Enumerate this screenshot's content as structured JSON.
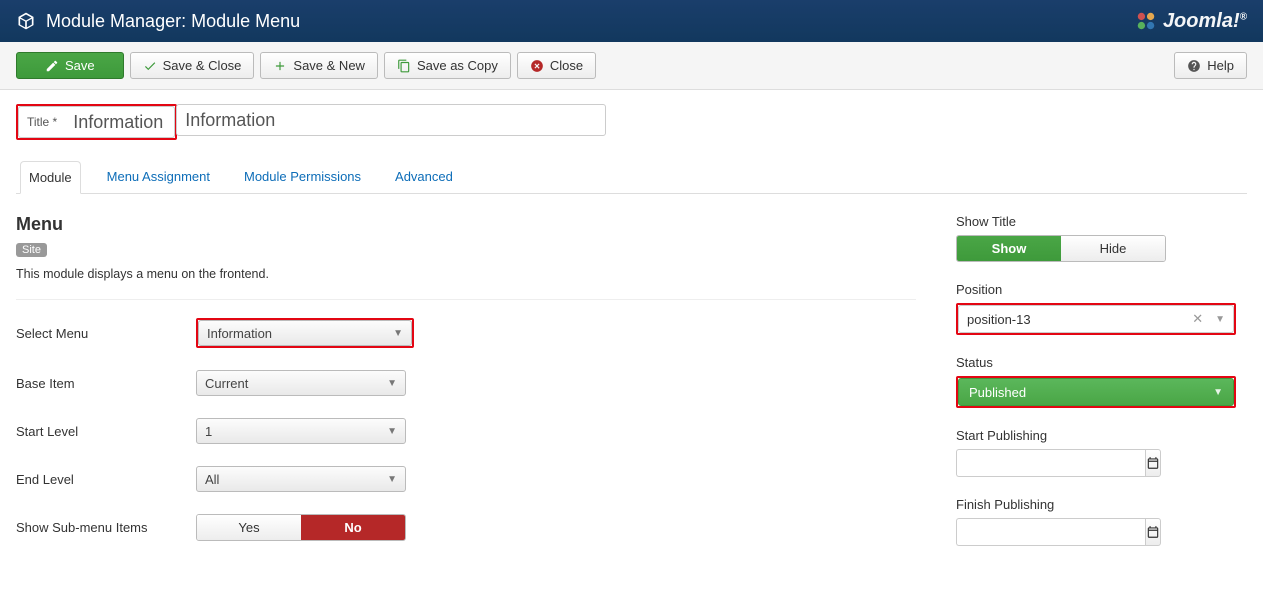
{
  "header": {
    "title": "Module Manager: Module Menu",
    "brand": "Joomla!"
  },
  "toolbar": {
    "save": "Save",
    "save_close": "Save & Close",
    "save_new": "Save & New",
    "save_copy": "Save as Copy",
    "close": "Close",
    "help": "Help"
  },
  "title_field": {
    "label": "Title *",
    "value": "Information"
  },
  "tabs": {
    "module": "Module",
    "menu_assignment": "Menu Assignment",
    "module_permissions": "Module Permissions",
    "advanced": "Advanced"
  },
  "module_section": {
    "heading": "Menu",
    "site_badge": "Site",
    "description": "This module displays a menu on the frontend."
  },
  "fields": {
    "select_menu": {
      "label": "Select Menu",
      "value": "Information"
    },
    "base_item": {
      "label": "Base Item",
      "value": "Current"
    },
    "start_level": {
      "label": "Start Level",
      "value": "1"
    },
    "end_level": {
      "label": "End Level",
      "value": "All"
    },
    "show_submenu": {
      "label": "Show Sub-menu Items",
      "yes": "Yes",
      "no": "No"
    }
  },
  "right": {
    "show_title": {
      "label": "Show Title",
      "show": "Show",
      "hide": "Hide"
    },
    "position": {
      "label": "Position",
      "value": "position-13"
    },
    "status": {
      "label": "Status",
      "value": "Published"
    },
    "start_pub": {
      "label": "Start Publishing",
      "value": ""
    },
    "finish_pub": {
      "label": "Finish Publishing",
      "value": ""
    }
  }
}
